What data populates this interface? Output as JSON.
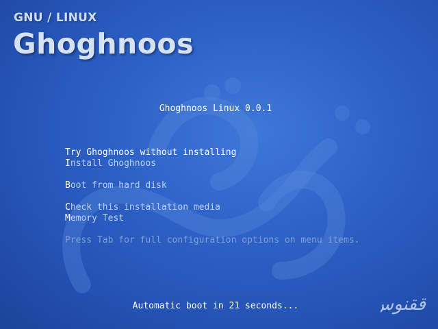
{
  "brand": {
    "subtitle": "GNU / LINUX",
    "name": "Ghoghnoos",
    "logo_text": "ققنوس"
  },
  "boot_menu": {
    "title": "Ghoghnoos Linux 0.0.1",
    "items": [
      {
        "hotkey": "T",
        "rest": "ry Ghoghnoos without installing",
        "selected": true
      },
      {
        "hotkey": "I",
        "rest": "nstall Ghoghnoos",
        "selected": false
      },
      {
        "hotkey": "B",
        "rest": "oot from hard disk",
        "selected": false
      },
      {
        "hotkey": "C",
        "rest": "heck this installation media",
        "selected": false
      },
      {
        "hotkey": "M",
        "rest": "emory Test",
        "selected": false
      }
    ],
    "hint": "Press Tab for full configuration options on menu items.",
    "autoboot": "Automatic boot in 21 seconds..."
  },
  "colors": {
    "background": "#2f63c8",
    "text_highlight": "#ffffff",
    "text_normal": "#b8cff0",
    "hint_text": "#7f9fd6"
  }
}
